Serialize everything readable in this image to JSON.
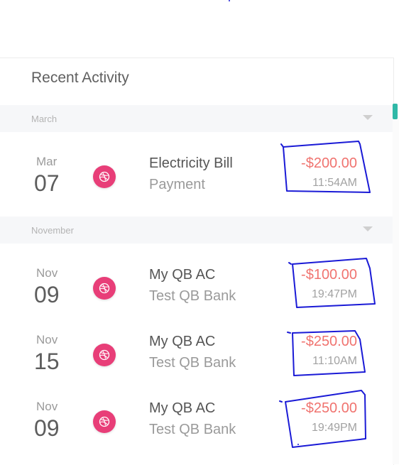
{
  "header": {
    "title": "Recent Activity"
  },
  "sections": [
    {
      "label": "March"
    },
    {
      "label": "November"
    }
  ],
  "transactions": [
    {
      "month": "Mar",
      "day": "07",
      "name": "Electricity Bill",
      "sub": "Payment",
      "amount": "-$200.00",
      "time": "11:54AM"
    },
    {
      "month": "Nov",
      "day": "09",
      "name": "My QB AC",
      "sub": "Test QB Bank",
      "amount": "-$100.00",
      "time": "19:47PM"
    },
    {
      "month": "Nov",
      "day": "15",
      "name": "My QB AC",
      "sub": "Test QB Bank",
      "amount": "-$250.00",
      "time": "11:10AM"
    },
    {
      "month": "Nov",
      "day": "09",
      "name": "My QB AC",
      "sub": "Test QB Bank",
      "amount": "-$250.00",
      "time": "19:49PM"
    }
  ],
  "colors": {
    "accent": "#2fb8a7",
    "icon_bg": "#e83e78",
    "amount": "#f0736f",
    "annotation": "#1a1ad6"
  },
  "icons": {
    "transaction": "dribbble-icon"
  }
}
